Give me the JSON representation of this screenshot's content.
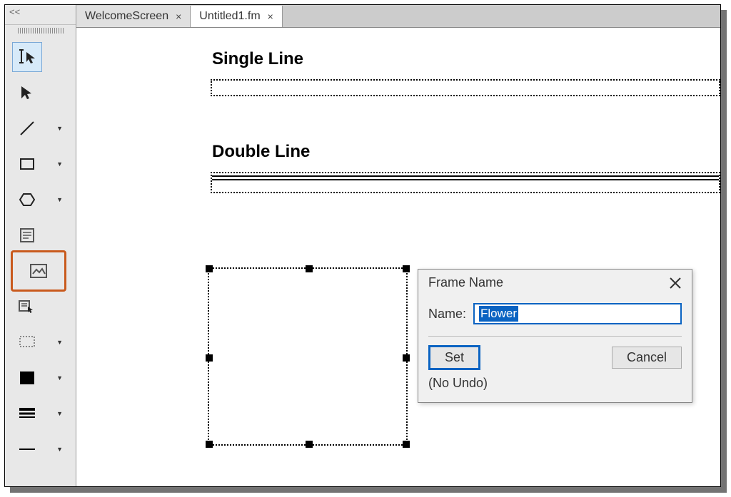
{
  "panel": {
    "collapse_glyph": "<<"
  },
  "tabs": [
    {
      "label": "WelcomeScreen",
      "close": "×",
      "active": false
    },
    {
      "label": "Untitled1.fm",
      "close": "×",
      "active": true
    }
  ],
  "document": {
    "heading_single": "Single Line",
    "heading_double": "Double Line"
  },
  "dialog": {
    "title": "Frame Name",
    "name_label": "Name:",
    "name_value": "Flower",
    "set_label": "Set",
    "cancel_label": "Cancel",
    "note": "(No Undo)"
  }
}
